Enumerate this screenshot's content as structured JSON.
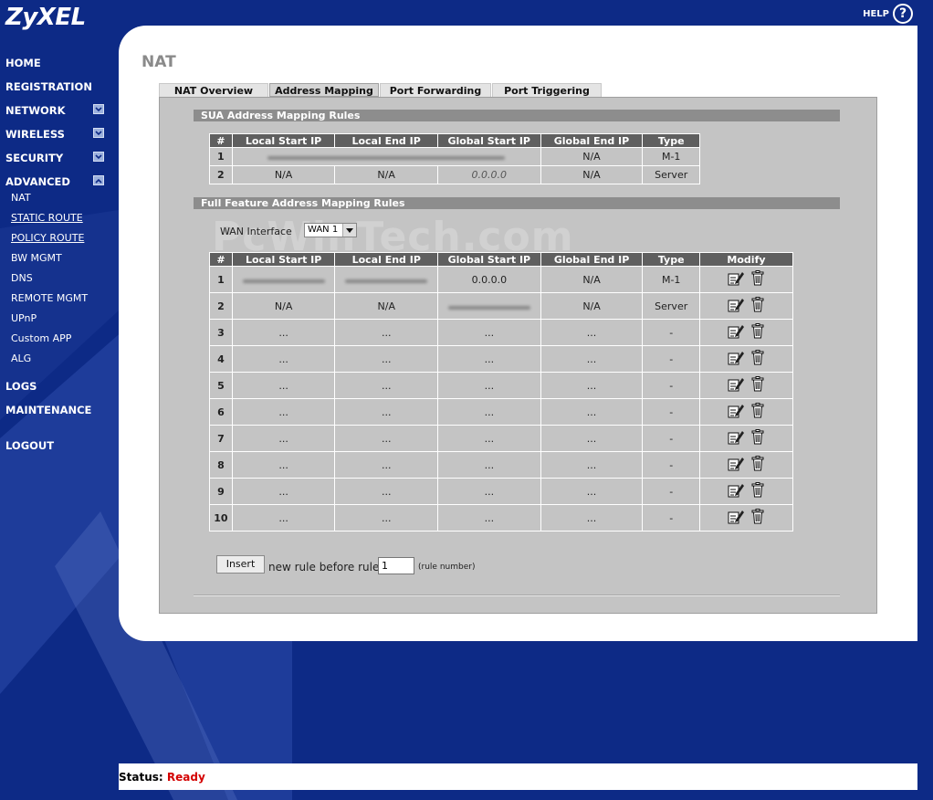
{
  "app": {
    "logo": "ZyXEL",
    "help": "HELP",
    "help_symbol": "?"
  },
  "nav": {
    "home": "HOME",
    "registration": "REGISTRATION",
    "network": "NETWORK",
    "wireless": "WIRELESS",
    "security": "SECURITY",
    "advanced": "ADVANCED",
    "advanced_items": [
      "NAT",
      "STATIC ROUTE",
      "POLICY ROUTE",
      "BW MGMT",
      "DNS",
      "REMOTE MGMT",
      "UPnP",
      "Custom APP",
      "ALG"
    ],
    "logs": "LOGS",
    "maintenance": "MAINTENANCE",
    "logout": "LOGOUT"
  },
  "page": {
    "title": "NAT"
  },
  "tabs": [
    "NAT Overview",
    "Address Mapping",
    "Port Forwarding",
    "Port Triggering"
  ],
  "active_tab": "Address Mapping",
  "sua": {
    "title": "SUA Address Mapping Rules",
    "columns": [
      "#",
      "Local Start IP",
      "Local End IP",
      "Global Start IP",
      "Global End IP",
      "Type"
    ],
    "rows": [
      {
        "num": "1",
        "local_start": "",
        "local_end": "",
        "global_start": "",
        "global_end": "N/A",
        "type": "M-1"
      },
      {
        "num": "2",
        "local_start": "N/A",
        "local_end": "N/A",
        "global_start": "0.0.0.0",
        "global_end": "N/A",
        "type": "Server"
      }
    ]
  },
  "full": {
    "title": "Full Feature Address Mapping Rules",
    "wan_label": "WAN Interface",
    "wan_value": "WAN 1",
    "columns": [
      "#",
      "Local Start IP",
      "Local End IP",
      "Global Start IP",
      "Global End IP",
      "Type",
      "Modify"
    ],
    "rows": [
      {
        "num": "1",
        "local_start": "",
        "local_end": "",
        "global_start": "0.0.0.0",
        "global_end": "N/A",
        "type": "M-1"
      },
      {
        "num": "2",
        "local_start": "N/A",
        "local_end": "N/A",
        "global_start": "",
        "global_end": "N/A",
        "type": "Server"
      },
      {
        "num": "3",
        "local_start": "...",
        "local_end": "...",
        "global_start": "...",
        "global_end": "...",
        "type": "-"
      },
      {
        "num": "4",
        "local_start": "...",
        "local_end": "...",
        "global_start": "...",
        "global_end": "...",
        "type": "-"
      },
      {
        "num": "5",
        "local_start": "...",
        "local_end": "...",
        "global_start": "...",
        "global_end": "...",
        "type": "-"
      },
      {
        "num": "6",
        "local_start": "...",
        "local_end": "...",
        "global_start": "...",
        "global_end": "...",
        "type": "-"
      },
      {
        "num": "7",
        "local_start": "...",
        "local_end": "...",
        "global_start": "...",
        "global_end": "...",
        "type": "-"
      },
      {
        "num": "8",
        "local_start": "...",
        "local_end": "...",
        "global_start": "...",
        "global_end": "...",
        "type": "-"
      },
      {
        "num": "9",
        "local_start": "...",
        "local_end": "...",
        "global_start": "...",
        "global_end": "...",
        "type": "-"
      },
      {
        "num": "10",
        "local_start": "...",
        "local_end": "...",
        "global_start": "...",
        "global_end": "...",
        "type": "-"
      }
    ]
  },
  "insert": {
    "button": "Insert",
    "text": "new rule before rule",
    "value": "1",
    "hint": "(rule number)"
  },
  "watermark": "PcWinTech.com",
  "status": {
    "label": "Status:",
    "value": "Ready"
  },
  "colors": {
    "background": "#0d2a86",
    "status_ready": "#d40000",
    "header_gray": "#5f5f5f"
  }
}
